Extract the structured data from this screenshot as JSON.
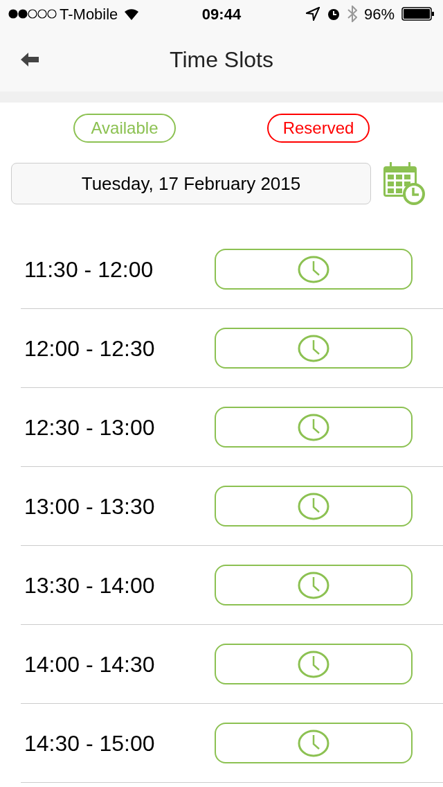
{
  "status_bar": {
    "carrier": "T-Mobile",
    "time": "09:44",
    "battery": "96%"
  },
  "header": {
    "title": "Time Slots"
  },
  "legend": [
    {
      "label": "Available",
      "color": "#8cc152"
    },
    {
      "label": "Reserved",
      "color": "#ff0000"
    }
  ],
  "date_field": {
    "value": "Tuesday, 17 February 2015"
  },
  "slots": [
    {
      "time": "11:30 - 12:00",
      "color": "#8cc152"
    },
    {
      "time": "12:00 - 12:30",
      "color": "#8cc152"
    },
    {
      "time": "12:30 - 13:00",
      "color": "#8cc152"
    },
    {
      "time": "13:00 - 13:30",
      "color": "#8cc152"
    },
    {
      "time": "13:30 - 14:00",
      "color": "#8cc152"
    },
    {
      "time": "14:00 - 14:30",
      "color": "#8cc152"
    },
    {
      "time": "14:30 - 15:00",
      "color": "#8cc152"
    }
  ]
}
